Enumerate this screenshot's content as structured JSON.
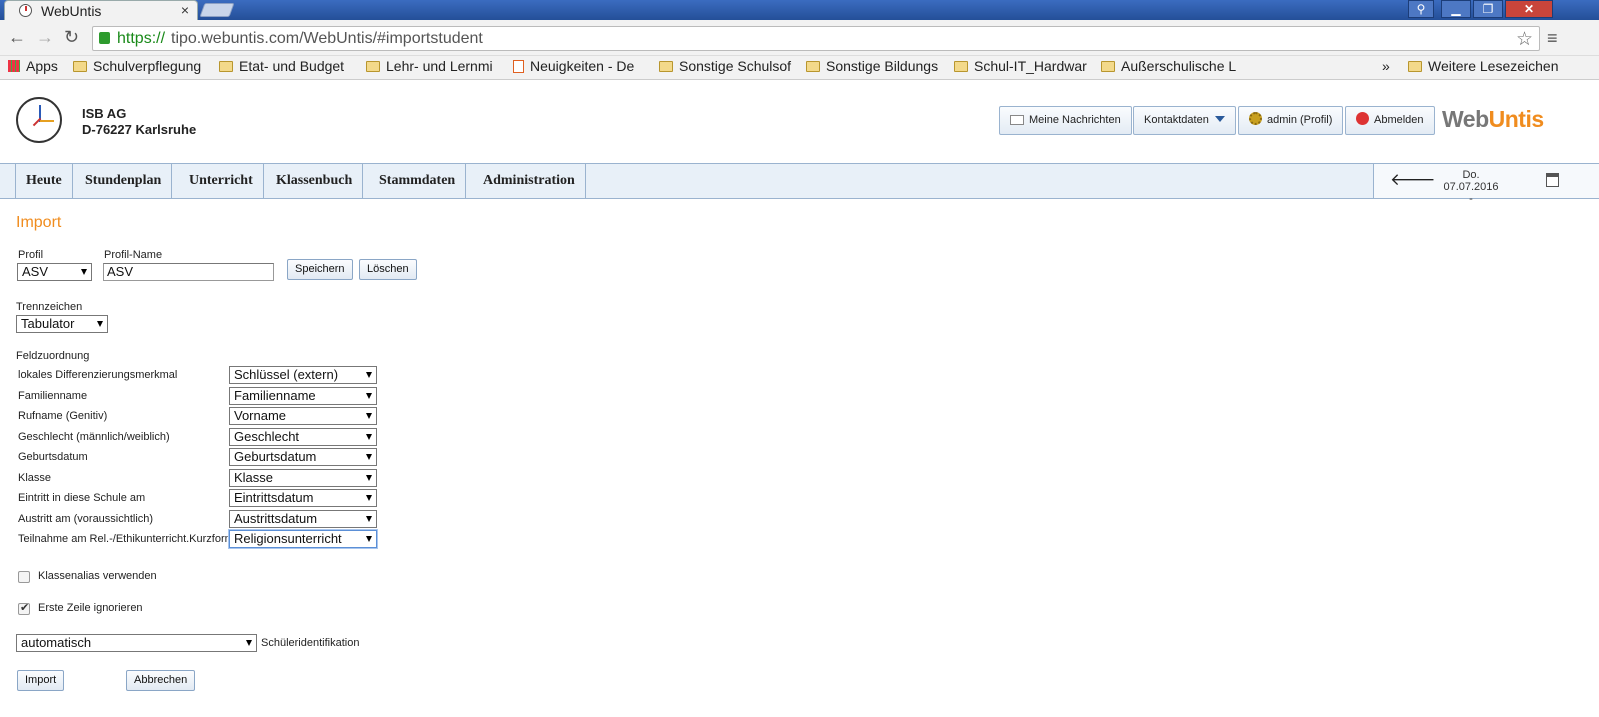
{
  "browser": {
    "tab_title": "WebUntis",
    "url_scheme": "https://",
    "url_rest": "tipo.webuntis.com/WebUntis/#importstudent",
    "bookmarks": [
      {
        "label": "Apps",
        "icon": "apps-icon"
      },
      {
        "label": "Schulverpflegung",
        "icon": "folder-icon"
      },
      {
        "label": "Etat- und Budget",
        "icon": "folder-icon"
      },
      {
        "label": "Lehr- und Lernmi",
        "icon": "folder-icon"
      },
      {
        "label": "Neuigkeiten - De",
        "icon": "page-icon"
      },
      {
        "label": "Sonstige Schulsof",
        "icon": "folder-icon"
      },
      {
        "label": "Sonstige Bildungs",
        "icon": "folder-icon"
      },
      {
        "label": "Schul-IT_Hardwar",
        "icon": "folder-icon"
      },
      {
        "label": "Außerschulische L",
        "icon": "folder-icon"
      }
    ],
    "bookmarks_overflow": "»",
    "other_bookmarks": "Weitere Lesezeichen"
  },
  "header": {
    "school_name": "ISB AG",
    "school_city": "D-76227 Karlsruhe",
    "messages_label": "Meine Nachrichten",
    "contact_label": "Kontaktdaten",
    "profile_label": "admin (Profil)",
    "logout_label": "Abmelden",
    "logo_part1": "Web",
    "logo_part2": "Untis"
  },
  "nav": {
    "items": [
      "Heute",
      "Stundenplan",
      "Unterricht",
      "Klassenbuch",
      "Stammdaten",
      "Administration"
    ],
    "date": "Do. 07.07.2016",
    "date_sub": "-"
  },
  "form": {
    "heading": "Import",
    "profile_label": "Profil",
    "profile_value": "ASV",
    "profile_name_label": "Profil-Name",
    "profile_name_value": "ASV",
    "save_label": "Speichern",
    "delete_label": "Löschen",
    "separator_label": "Trennzeichen",
    "separator_value": "Tabulator",
    "mapping_label": "Feldzuordnung",
    "mappings": [
      {
        "field": "lokales Differenzierungsmerkmal",
        "value": "Schlüssel (extern)"
      },
      {
        "field": "Familienname",
        "value": "Familienname"
      },
      {
        "field": "Rufname (Genitiv)",
        "value": "Vorname"
      },
      {
        "field": "Geschlecht (männlich/weiblich)",
        "value": "Geschlecht"
      },
      {
        "field": "Geburtsdatum",
        "value": "Geburtsdatum"
      },
      {
        "field": "Klasse",
        "value": "Klasse"
      },
      {
        "field": "Eintritt in diese Schule am",
        "value": "Eintrittsdatum"
      },
      {
        "field": "Austritt am (voraussichtlich)",
        "value": "Austrittsdatum"
      },
      {
        "field": "Teilnahme am Rel.-/Ethikunterricht.Kurzform",
        "value": "Religionsunterricht"
      }
    ],
    "class_alias_label": "Klassenalias verwenden",
    "class_alias_checked": false,
    "ignore_first_row_label": "Erste Zeile ignorieren",
    "ignore_first_row_checked": true,
    "identification_value": "automatisch",
    "identification_label": "Schüleridentifikation",
    "import_label": "Import",
    "cancel_label": "Abbrechen"
  }
}
